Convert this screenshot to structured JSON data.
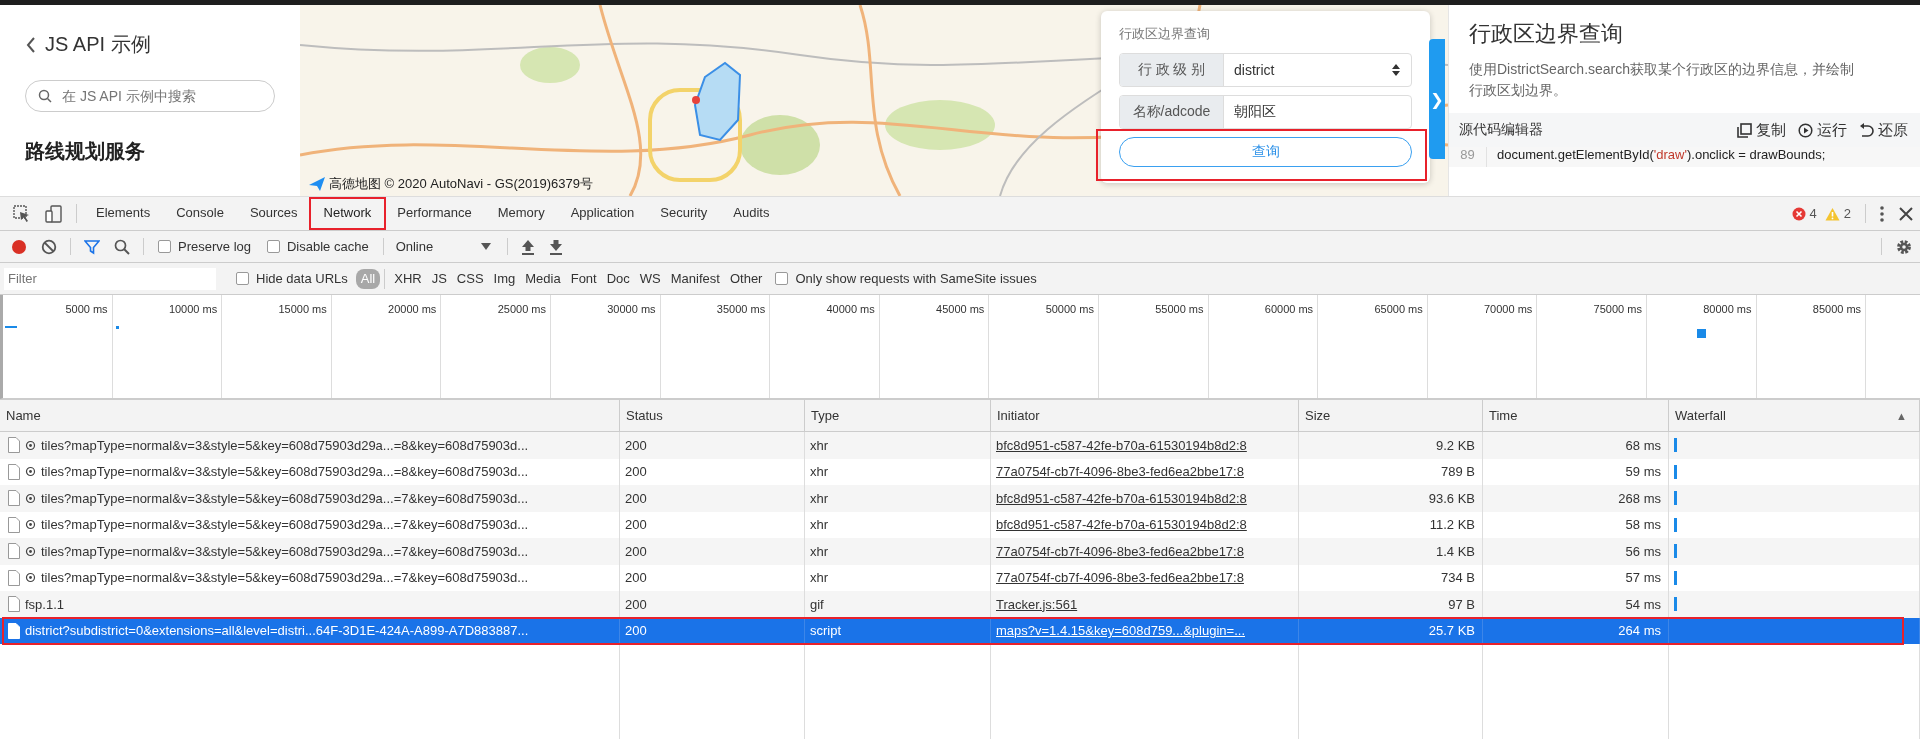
{
  "sidebar": {
    "back_link": "JS API 示例",
    "search": {
      "placeholder": "在 JS API 示例中搜索"
    },
    "heading": "路线规划服务"
  },
  "map": {
    "attribution": "高德地图 © 2020 AutoNavi - GS(2019)6379号",
    "handle": "❯",
    "panel": {
      "title": "行政区边界查询",
      "fields": [
        {
          "kind": "select",
          "label": "行 政 级 别",
          "value": "district"
        },
        {
          "kind": "input",
          "label": "名称/adcode",
          "value": "朝阳区"
        }
      ],
      "button": {
        "label": "查询",
        "highlighted": true
      }
    }
  },
  "doc": {
    "title": "行政区边界查询",
    "description": "使用DistrictSearch.search获取某个行政区的边界信息，并绘制行政区划边界。",
    "editor_label": "源代码编辑器",
    "actions": [
      {
        "kind": "copy",
        "label": "复制"
      },
      {
        "kind": "run",
        "label": "运行"
      },
      {
        "kind": "restore",
        "label": "还原"
      }
    ],
    "code_line": {
      "number": "89",
      "parts": [
        {
          "kind": "plain",
          "text": "document.getElementById("
        },
        {
          "kind": "string",
          "text": "'draw'"
        },
        {
          "kind": "plain",
          "text": ").onclick = drawBounds;"
        }
      ]
    }
  },
  "devtools": {
    "tabs": [
      {
        "label": "Elements",
        "selected": false,
        "highlighted": false
      },
      {
        "label": "Console",
        "selected": false,
        "highlighted": false
      },
      {
        "label": "Sources",
        "selected": false,
        "highlighted": false
      },
      {
        "label": "Network",
        "selected": true,
        "highlighted": true
      },
      {
        "label": "Performance",
        "selected": false,
        "highlighted": false
      },
      {
        "label": "Memory",
        "selected": false,
        "highlighted": false
      },
      {
        "label": "Application",
        "selected": false,
        "highlighted": false
      },
      {
        "label": "Security",
        "selected": false,
        "highlighted": false
      },
      {
        "label": "Audits",
        "selected": false,
        "highlighted": false
      }
    ],
    "errors": "4",
    "warnings": "2",
    "toolbar": {
      "recording": true,
      "filter_active": true,
      "preserve_log": {
        "label": "Preserve log",
        "checked": false
      },
      "disable_cache": {
        "label": "Disable cache",
        "checked": false
      },
      "throttle": "Online"
    },
    "filter_bar": {
      "placeholder": "Filter",
      "hide_data_urls": {
        "label": "Hide data URLs",
        "checked": false
      },
      "types": [
        {
          "label": "All",
          "selected": true
        },
        {
          "label": "XHR",
          "selected": false
        },
        {
          "label": "JS",
          "selected": false
        },
        {
          "label": "CSS",
          "selected": false
        },
        {
          "label": "Img",
          "selected": false
        },
        {
          "label": "Media",
          "selected": false
        },
        {
          "label": "Font",
          "selected": false
        },
        {
          "label": "Doc",
          "selected": false
        },
        {
          "label": "WS",
          "selected": false
        },
        {
          "label": "Manifest",
          "selected": false
        },
        {
          "label": "Other",
          "selected": false
        }
      ],
      "samesite": {
        "label": "Only show requests with SameSite issues",
        "checked": false
      }
    },
    "overview": {
      "ticks": [
        "5000 ms",
        "10000 ms",
        "15000 ms",
        "20000 ms",
        "25000 ms",
        "30000 ms",
        "35000 ms",
        "40000 ms",
        "45000 ms",
        "50000 ms",
        "55000 ms",
        "60000 ms",
        "65000 ms",
        "70000 ms",
        "75000 ms",
        "80000 ms",
        "85000 ms"
      ]
    },
    "table": {
      "columns": [
        {
          "label": "Name"
        },
        {
          "label": "Status"
        },
        {
          "label": "Type"
        },
        {
          "label": "Initiator"
        },
        {
          "label": "Size"
        },
        {
          "label": "Time"
        },
        {
          "label": "Waterfall",
          "sort": "▲"
        }
      ],
      "rows": [
        {
          "name": "tiles?mapType=normal&v=3&style=5&key=608d75903d29a...=8&key=608d75903d...",
          "service_worker": true,
          "status": "200",
          "type": "xhr",
          "initiator": "bfc8d951-c587-42fe-b70a-61530194b8d2:8",
          "size": "9.2 KB",
          "time": "68 ms",
          "selected": false,
          "highlighted": false
        },
        {
          "name": "tiles?mapType=normal&v=3&style=5&key=608d75903d29a...=8&key=608d75903d...",
          "service_worker": true,
          "status": "200",
          "type": "xhr",
          "initiator": "77a0754f-cb7f-4096-8be3-fed6ea2bbe17:8",
          "size": "789 B",
          "time": "59 ms",
          "selected": false,
          "highlighted": false
        },
        {
          "name": "tiles?mapType=normal&v=3&style=5&key=608d75903d29a...=7&key=608d75903d...",
          "service_worker": true,
          "status": "200",
          "type": "xhr",
          "initiator": "bfc8d951-c587-42fe-b70a-61530194b8d2:8",
          "size": "93.6 KB",
          "time": "268 ms",
          "selected": false,
          "highlighted": false
        },
        {
          "name": "tiles?mapType=normal&v=3&style=5&key=608d75903d29a...=7&key=608d75903d...",
          "service_worker": true,
          "status": "200",
          "type": "xhr",
          "initiator": "bfc8d951-c587-42fe-b70a-61530194b8d2:8",
          "size": "11.2 KB",
          "time": "58 ms",
          "selected": false,
          "highlighted": false
        },
        {
          "name": "tiles?mapType=normal&v=3&style=5&key=608d75903d29a...=7&key=608d75903d...",
          "service_worker": true,
          "status": "200",
          "type": "xhr",
          "initiator": "77a0754f-cb7f-4096-8be3-fed6ea2bbe17:8",
          "size": "1.4 KB",
          "time": "56 ms",
          "selected": false,
          "highlighted": false
        },
        {
          "name": "tiles?mapType=normal&v=3&style=5&key=608d75903d29a...=7&key=608d75903d...",
          "service_worker": true,
          "status": "200",
          "type": "xhr",
          "initiator": "77a0754f-cb7f-4096-8be3-fed6ea2bbe17:8",
          "size": "734 B",
          "time": "57 ms",
          "selected": false,
          "highlighted": false
        },
        {
          "name": "fsp.1.1",
          "service_worker": false,
          "status": "200",
          "type": "gif",
          "initiator": "Tracker.js:561",
          "size": "97 B",
          "time": "54 ms",
          "selected": false,
          "highlighted": false
        },
        {
          "name": "district?subdistrict=0&extensions=all&level=distri...64F-3D1E-424A-A899-A7D883887...",
          "service_worker": false,
          "status": "200",
          "type": "script",
          "initiator": "maps?v=1.4.15&key=608d759...&plugin=...",
          "size": "25.7 KB",
          "time": "264 ms",
          "selected": true,
          "highlighted": true
        }
      ]
    }
  }
}
